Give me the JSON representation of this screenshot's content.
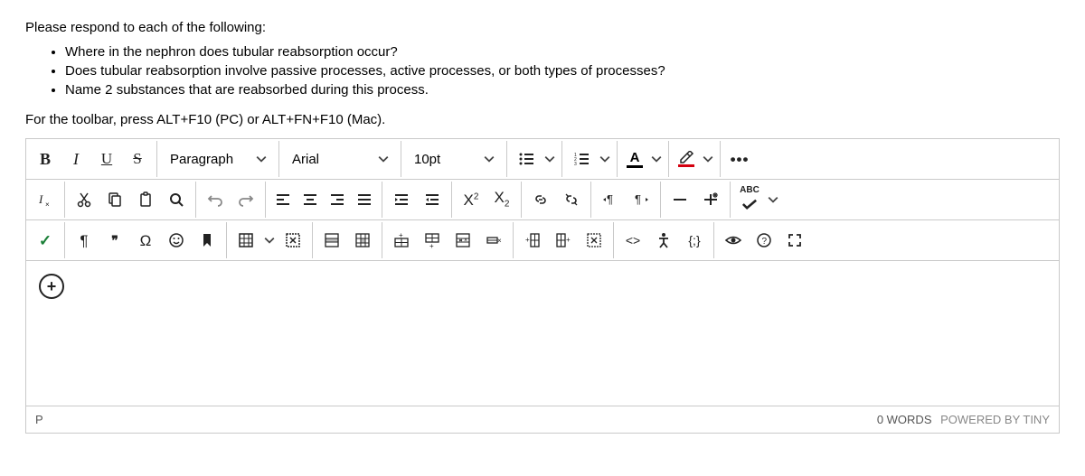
{
  "question": {
    "intro": "Please respond to each of the following:",
    "items": [
      "Where in the nephron does tubular reabsorption occur?",
      "Does tubular reabsorption involve passive processes, active processes, or both types of processes?",
      "Name 2 substances that are reabsorbed during this process."
    ],
    "toolbar_hint": "For the toolbar, press ALT+F10 (PC) or ALT+FN+F10 (Mac)."
  },
  "toolbar": {
    "bold": "B",
    "italic": "I",
    "underline": "U",
    "strike": "S",
    "paragraph_style": "Paragraph",
    "font_family": "Arial",
    "font_size": "10pt",
    "text_color_letter": "A",
    "text_color_value": "#000000",
    "highlight_color_value": "#d4000f",
    "more": "•••",
    "abc": "ABC",
    "code_braces": "{;}",
    "code_angle": "<>",
    "quote": "❝❞",
    "omega": "Ω",
    "checkmark": "✓"
  },
  "statusbar": {
    "path": "P",
    "word_count": "0 WORDS",
    "powered": "POWERED BY TINY"
  }
}
